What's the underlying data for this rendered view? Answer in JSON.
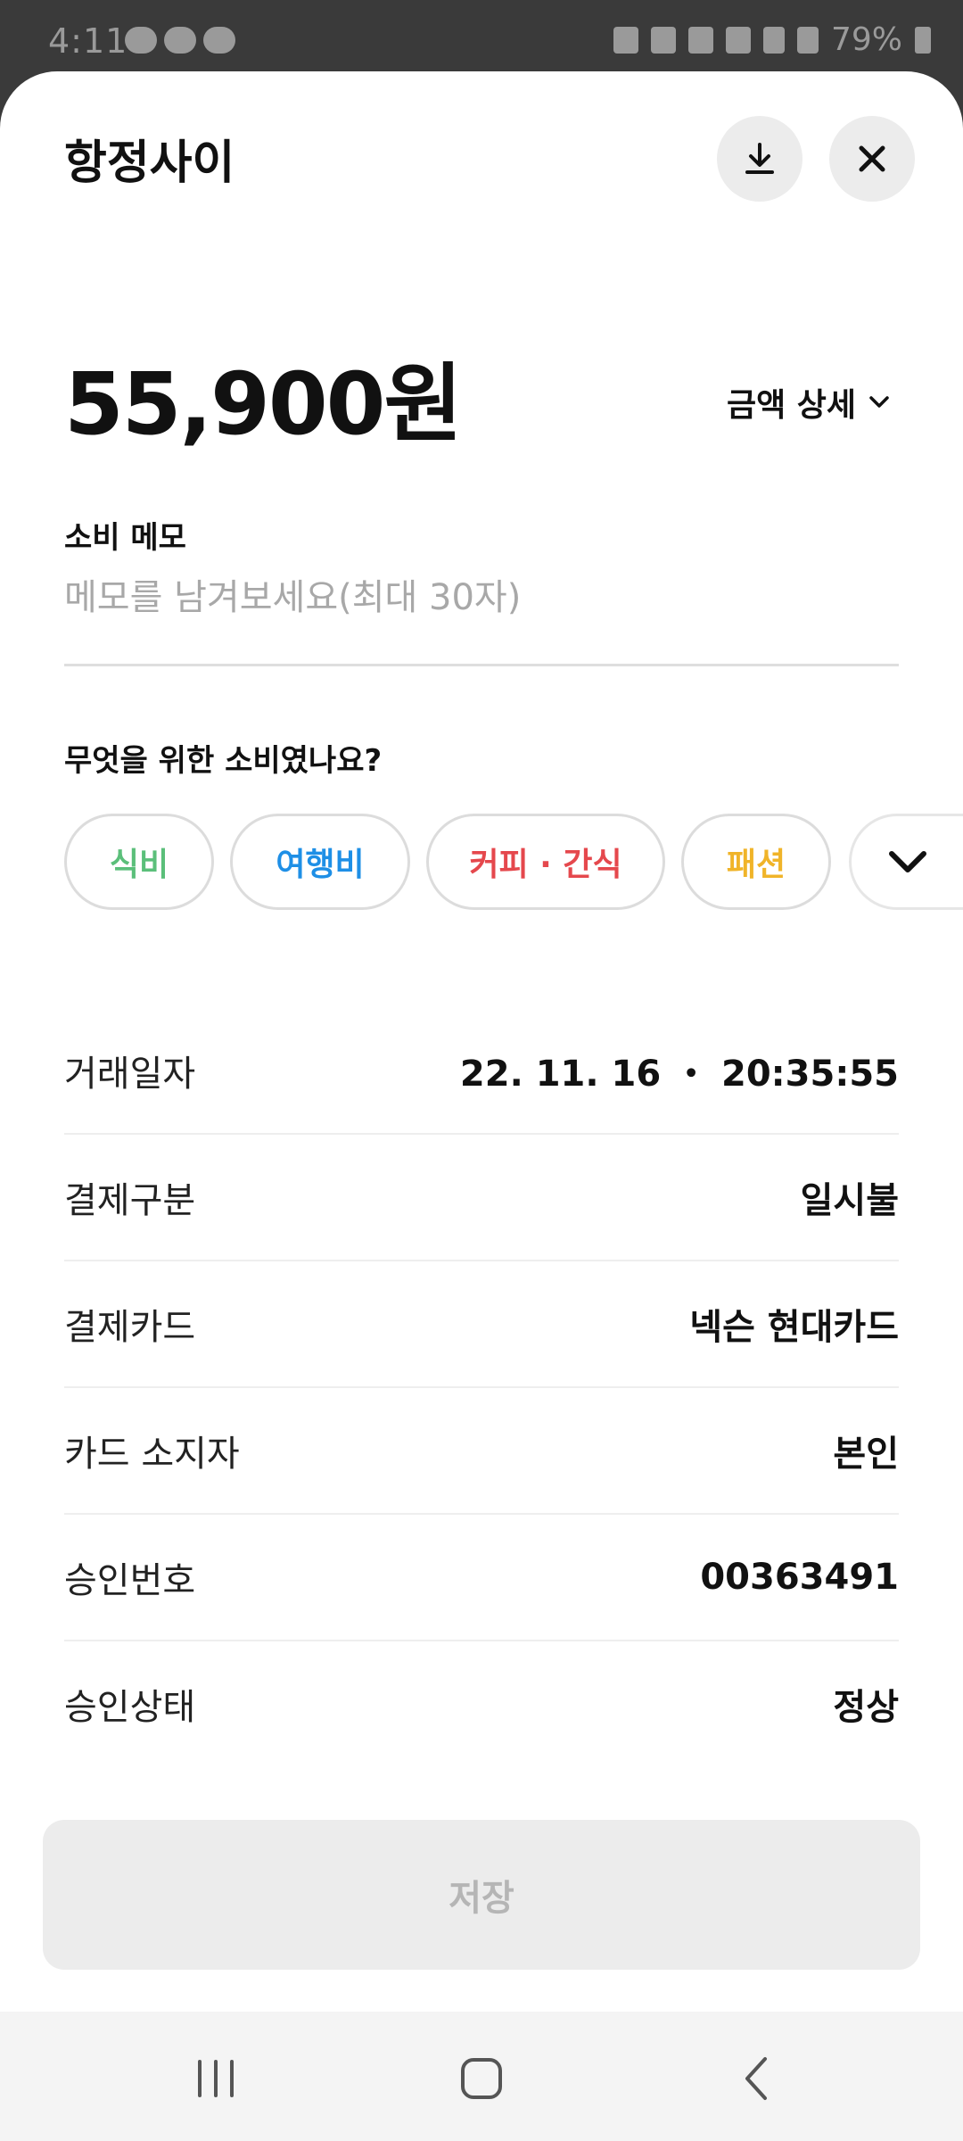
{
  "status_bar": {
    "time": "4:11",
    "battery_percent": "79%",
    "icons": [
      "chat-bubble-icon",
      "talk-icon",
      "s-icon",
      "battery-saver-icon",
      "alarm-icon",
      "mute-icon",
      "hd-voice-icon",
      "lte-icon",
      "signal-icon",
      "battery-icon"
    ]
  },
  "header": {
    "merchant": "항정사이",
    "download_icon": "download-icon",
    "close_icon": "close-icon"
  },
  "amount": {
    "value": "55,900원",
    "detail_label": "금액 상세"
  },
  "memo": {
    "label": "소비 메모",
    "value": "",
    "placeholder": "메모를 남겨보세요(최대 30자)"
  },
  "category": {
    "question": "무엇을 위한 소비였나요?",
    "chips": [
      {
        "label": "식비",
        "color": "#5bbf7a"
      },
      {
        "label": "여행비",
        "color": "#1e8fe6"
      },
      {
        "label": "커피 · 간식",
        "color": "#e5484d"
      },
      {
        "label": "패션",
        "color": "#f0b429"
      }
    ]
  },
  "details": [
    {
      "label": "거래일자",
      "value": "22. 11. 16 ・ 20:35:55"
    },
    {
      "label": "결제구분",
      "value": "일시불"
    },
    {
      "label": "결제카드",
      "value": "넥슨 현대카드"
    },
    {
      "label": "카드 소지자",
      "value": "본인"
    },
    {
      "label": "승인번호",
      "value": "00363491"
    },
    {
      "label": "승인상태",
      "value": "정상"
    }
  ],
  "save_button": {
    "label": "저장"
  },
  "nav_bar": {
    "recents_icon": "recents-icon",
    "home_icon": "home-icon",
    "back_icon": "back-icon"
  }
}
